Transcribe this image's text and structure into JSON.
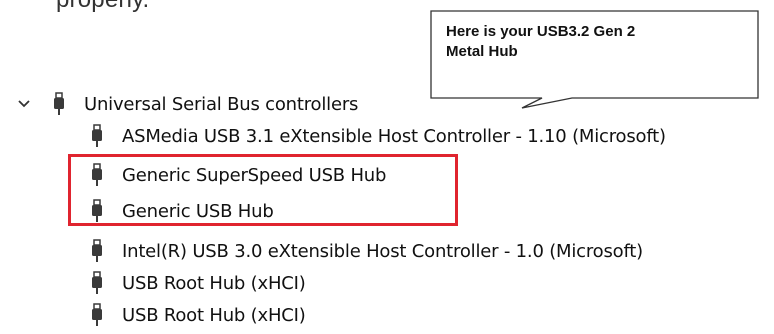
{
  "top_text": "properly.",
  "callout": {
    "line1": "Here is your USB3.2 Gen 2",
    "line2": "Metal Hub"
  },
  "tree": {
    "category": {
      "label": "Universal Serial Bus controllers",
      "expanded": true,
      "icon": "usb-plug-icon"
    },
    "devices": [
      {
        "label": "ASMedia USB 3.1 eXtensible Host Controller - 1.10 (Microsoft)",
        "icon": "usb-plug-icon"
      },
      {
        "label": "Generic SuperSpeed USB Hub",
        "icon": "usb-plug-icon"
      },
      {
        "label": "Generic USB Hub",
        "icon": "usb-plug-icon"
      },
      {
        "label": "Intel(R) USB 3.0 eXtensible Host Controller - 1.0 (Microsoft)",
        "icon": "usb-plug-icon"
      },
      {
        "label": "USB Root Hub (xHCI)",
        "icon": "usb-plug-icon"
      },
      {
        "label": "USB Root Hub (xHCI)",
        "icon": "usb-plug-icon"
      }
    ]
  },
  "colors": {
    "highlight": "#e0242f",
    "text": "#111111",
    "icon": "#3a3a3a"
  }
}
